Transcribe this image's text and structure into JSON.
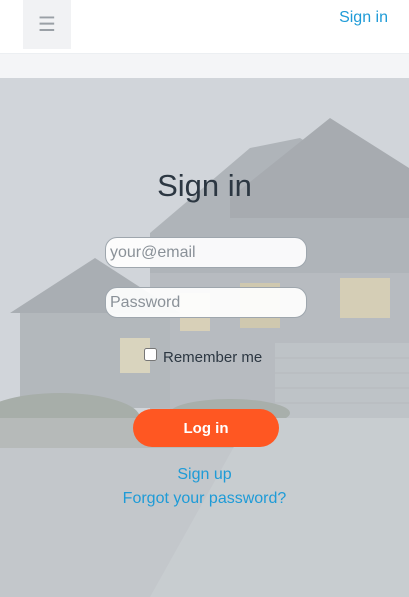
{
  "header": {
    "menu_glyph": "☰",
    "sign_in_link": "Sign in"
  },
  "login": {
    "title": "Sign in",
    "email_placeholder": "your@email",
    "password_placeholder": "Password",
    "remember_label": "Remember me",
    "remember_checked": false,
    "submit_label": "Log in",
    "signup_link": "Sign up",
    "forgot_link": "Forgot your password?"
  },
  "colors": {
    "accent": "#ff5722",
    "link": "#1e9bd7",
    "title": "#2c3742"
  },
  "icons": {
    "menu": "hamburger-menu-icon"
  }
}
